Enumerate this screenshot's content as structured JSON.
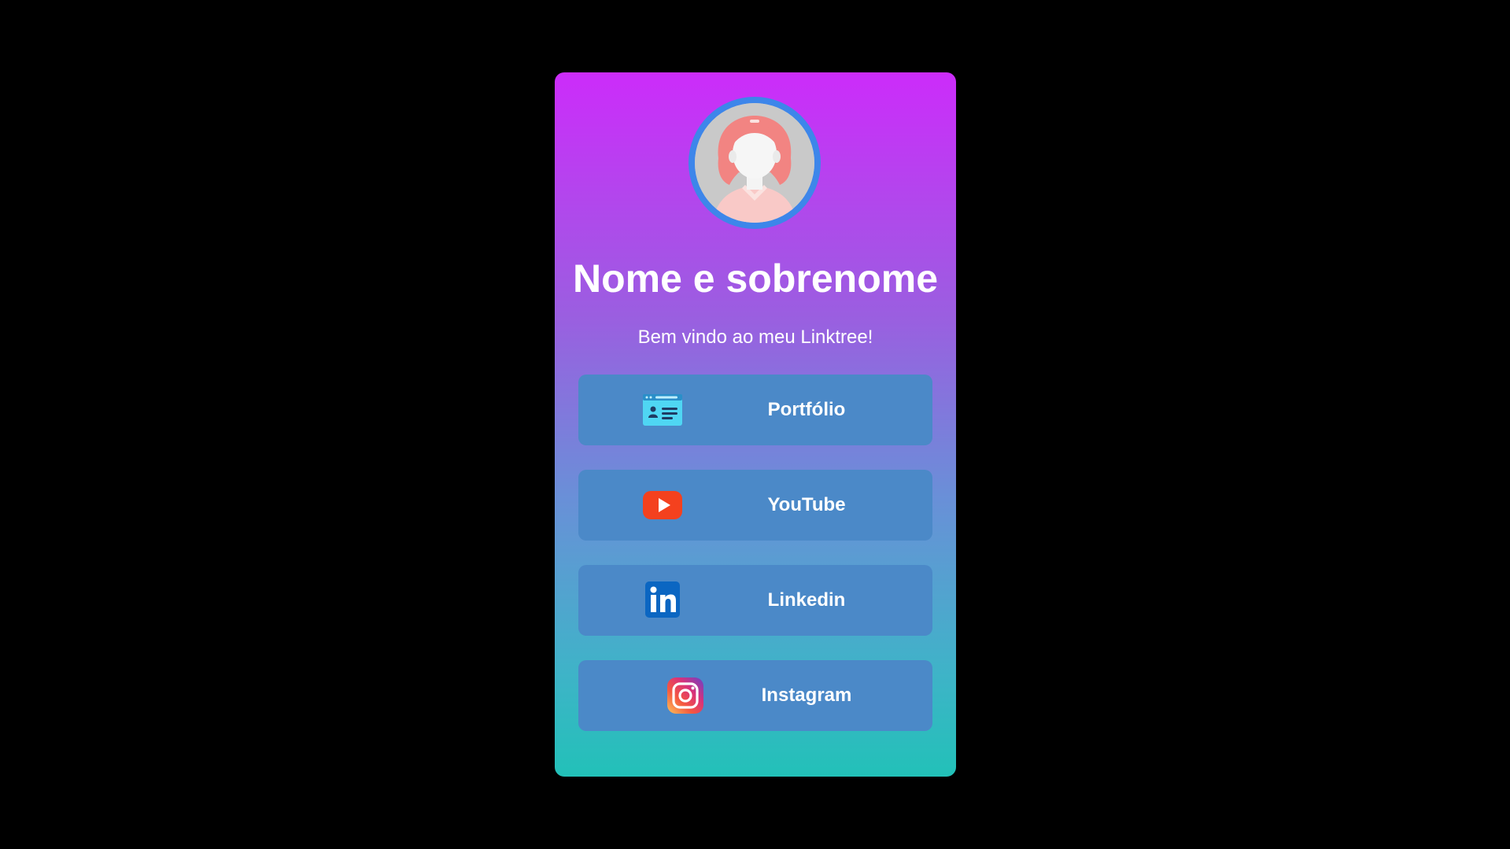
{
  "profile": {
    "name": "Nome e sobrenome",
    "welcome": "Bem vindo ao meu Linktree!"
  },
  "links": [
    {
      "label": "Portfólio",
      "icon": "portfolio-card-icon"
    },
    {
      "label": "YouTube",
      "icon": "youtube-icon"
    },
    {
      "label": "Linkedin",
      "icon": "linkedin-icon"
    },
    {
      "label": "Instagram",
      "icon": "instagram-icon"
    }
  ],
  "colors": {
    "background": "#000000",
    "gradient_top": "#cc2cfa",
    "gradient_bottom": "#22c1b8",
    "button": "#4b89c8",
    "avatar_ring": "#3d86ea"
  }
}
